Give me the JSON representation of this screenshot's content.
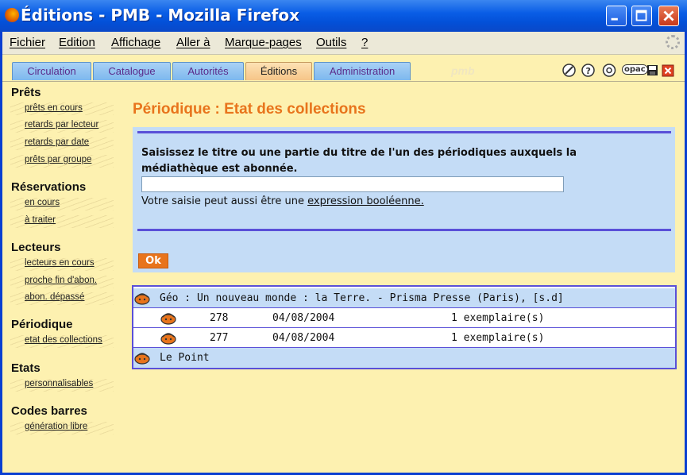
{
  "window": {
    "title": "Éditions - PMB - Mozilla Firefox"
  },
  "menu": [
    "Fichier",
    "Edition",
    "Affichage",
    "Aller à",
    "Marque-pages",
    "Outils",
    "?"
  ],
  "tabs": [
    {
      "label": "Circulation",
      "active": false
    },
    {
      "label": "Catalogue",
      "active": false
    },
    {
      "label": "Autorités",
      "active": false
    },
    {
      "label": "Éditions",
      "active": true
    },
    {
      "label": "Administration",
      "active": false
    }
  ],
  "toolbar_logo": "pmb",
  "toolbar_icons": [
    "tools-icon",
    "help-icon",
    "settings-icon",
    "opac-icon",
    "save-icon",
    "close-icon"
  ],
  "toolbar_opac_label": "opac",
  "sidebar": {
    "sections": [
      {
        "title": "Prêts",
        "links": [
          "prêts en cours",
          "retards par lecteur",
          "retards par date",
          "prêts par groupe"
        ]
      },
      {
        "title": "Réservations",
        "links": [
          "en cours",
          "à traiter"
        ]
      },
      {
        "title": "Lecteurs",
        "links": [
          "lecteurs en cours",
          "proche fin d'abon.",
          "abon. dépassé"
        ]
      },
      {
        "title": "Périodique",
        "links": [
          "etat des collections"
        ]
      },
      {
        "title": "Etats",
        "links": [
          "personnalisables"
        ]
      },
      {
        "title": "Codes barres",
        "links": [
          "génération libre"
        ]
      }
    ]
  },
  "main": {
    "heading": "Périodique : Etat des collections",
    "prompt": "Saisissez le titre ou une partie du titre de l'un des périodiques auxquels la médiathèque est abonnée.",
    "search_value": "",
    "hint_prefix": "Votre saisie peut aussi être une ",
    "hint_link": "expression booléenne.",
    "ok_label": "Ok"
  },
  "results": {
    "periodicals": [
      {
        "title": "Géo : Un nouveau monde : la Terre. - Prisma Presse (Paris), [s.d]",
        "issues": [
          {
            "number": "278",
            "date": "04/08/2004",
            "copies": "1 exemplaire(s)"
          },
          {
            "number": "277",
            "date": "04/08/2004",
            "copies": "1 exemplaire(s)"
          }
        ]
      },
      {
        "title": "Le Point",
        "issues": []
      }
    ]
  },
  "colors": {
    "accent": "#e8741c",
    "panel": "#c4dcf6",
    "rule": "#5a50d8",
    "background": "#fdf1b0"
  }
}
